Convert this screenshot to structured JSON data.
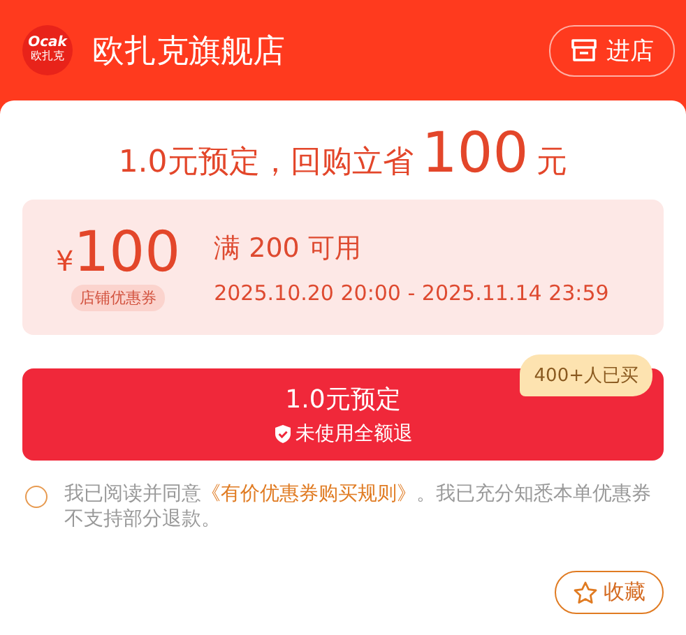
{
  "header": {
    "logo": {
      "latin": "Ocak",
      "cjk": "欧扎克"
    },
    "store_name": "欧扎克旗舰店",
    "enter_button": "进店"
  },
  "headline": {
    "prefix": "1.0元预定，回购立省",
    "amount": "100",
    "suffix": "元"
  },
  "coupon": {
    "currency": "¥",
    "value": "100",
    "tag": "店铺优惠券",
    "condition": "满 200 可用",
    "validity": "2025.10.20 20:00 - 2025.11.14 23:59"
  },
  "reserve_button": {
    "label": "1.0元预定",
    "guarantee": "未使用全额退",
    "badge": "400+人已买"
  },
  "agreement": {
    "checked": false,
    "before": "我已阅读并同意",
    "link": "《有价优惠券购买规则》",
    "after": "。我已充分知悉本单优惠券不支持部分退款。"
  },
  "favorite_button": {
    "label": "收藏"
  }
}
